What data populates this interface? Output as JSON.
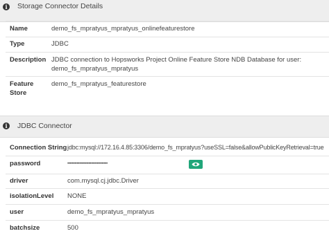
{
  "storage_section": {
    "title": "Storage Connector Details",
    "rows": [
      {
        "label": "Name",
        "value": "demo_fs_mpratyus_mpratyus_onlinefeaturestore"
      },
      {
        "label": "Type",
        "value": "JDBC"
      },
      {
        "label": "Description",
        "value": "JDBC connection to Hopsworks Project Online Feature Store NDB Database for user: demo_fs_mpratyus_mpratyus"
      },
      {
        "label": "Feature Store",
        "value": "demo_fs_mpratyus_featurestore"
      }
    ]
  },
  "jdbc_section": {
    "title": "JDBC Connector",
    "rows": [
      {
        "label": "Connection String",
        "value": "jdbc:mysql://172.16.4.85:3306/demo_fs_mpratyus?useSSL=false&allowPublicKeyRetrieval=true"
      },
      {
        "label": "password",
        "value": "••••••••••••••••••••••••••••••••••"
      },
      {
        "label": "driver",
        "value": "com.mysql.cj.jdbc.Driver"
      },
      {
        "label": "isolationLevel",
        "value": "NONE"
      },
      {
        "label": "user",
        "value": "demo_fs_mpratyus_mpratyus"
      },
      {
        "label": "batchsize",
        "value": "500"
      }
    ]
  },
  "icons": {
    "section_header": "info-icon",
    "password_reveal": "eye-icon"
  },
  "colors": {
    "header_bg": "#eeeeee",
    "reveal_button": "#21a67a"
  }
}
